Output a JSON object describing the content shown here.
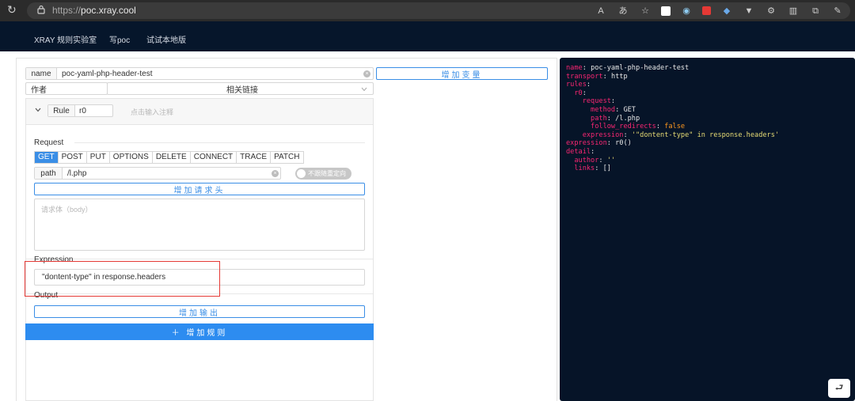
{
  "browser": {
    "url_protocol": "https://",
    "url_host": "poc.xray.cool",
    "icons": [
      "reader-mode-icon",
      "translate-icon",
      "favorite-icon",
      "extension-icon-1",
      "extension-icon-2",
      "extension-icon-3",
      "extension-icon-4",
      "extension-icon-5",
      "extensions-icon",
      "split-screen-icon",
      "collections-icon",
      "copilot-icon"
    ]
  },
  "nav": {
    "items": [
      "XRAY 规则实验室",
      "写poc",
      "试试本地版"
    ]
  },
  "form": {
    "name_label": "name",
    "name_value": "poc-yaml-php-header-test",
    "add_variable": "增加变量",
    "author_placeholder": "作者",
    "links_placeholder": "相关链接"
  },
  "rule": {
    "rule_label": "Rule",
    "rule_name": "r0",
    "comment_placeholder": "点击输入注释",
    "request_title": "Request",
    "methods": [
      "GET",
      "POST",
      "PUT",
      "OPTIONS",
      "DELETE",
      "CONNECT",
      "TRACE",
      "PATCH"
    ],
    "active_method": "GET",
    "path_label": "path",
    "path_value": "/l.php",
    "redirect_toggle": "不跟随重定向",
    "add_header": "增加请求头",
    "body_placeholder": "请求体（body）",
    "expression_title": "Expression",
    "expression_value": "\"dontent-type\" in response.headers",
    "output_title": "Output",
    "add_output": "增加输出",
    "add_rule": "＋ 增加规则"
  },
  "yaml": {
    "lines": [
      {
        "key": "name",
        "value": "poc-yaml-php-header-test"
      },
      {
        "key": "transport",
        "value": "http"
      },
      {
        "key": "rules",
        "value": ""
      },
      {
        "key": "r0",
        "value": ""
      },
      {
        "key": "request",
        "value": ""
      },
      {
        "key": "method",
        "value": "GET"
      },
      {
        "key": "path",
        "value": "/l.php"
      },
      {
        "key": "follow_redirects",
        "value": "false"
      },
      {
        "key": "expression",
        "value": "'\"dontent-type\" in response.headers'"
      },
      {
        "key": "expression",
        "value": "r0()"
      },
      {
        "key": "detail",
        "value": ""
      },
      {
        "key": "author",
        "value": "''"
      },
      {
        "key": "links",
        "value": "[]"
      }
    ]
  },
  "colors": {
    "accent": "#2d8cf0",
    "nav_bg": "#06162b",
    "code_bg": "#061428",
    "yaml_key": "#f92672",
    "yaml_string": "#e6db74",
    "yaml_bool": "#fd971f",
    "highlight_box": "#e53935"
  }
}
